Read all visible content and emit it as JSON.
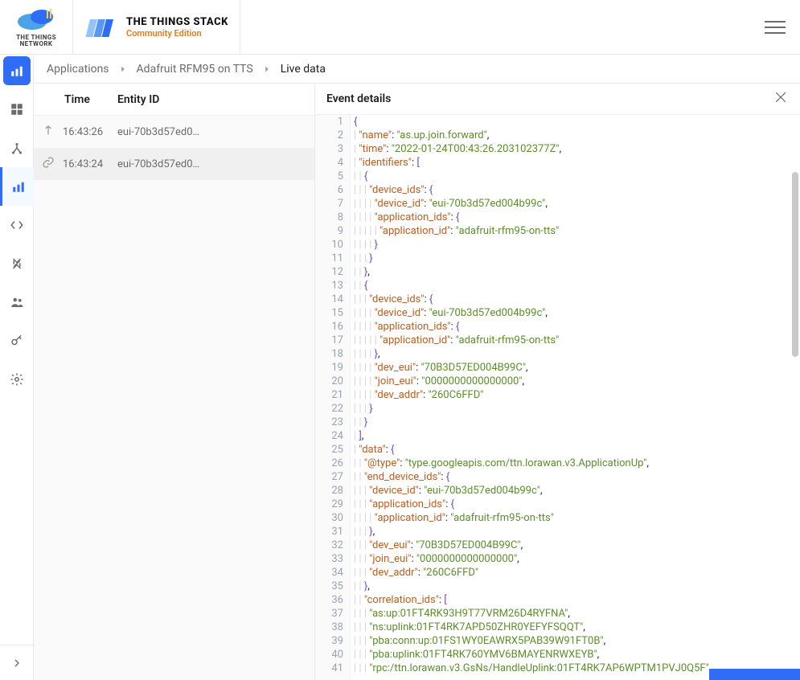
{
  "header": {
    "ttn_logo_line1": "THE THINGS",
    "ttn_logo_line2": "NETWORK",
    "tts_title": "THE THINGS STACK",
    "tts_sub": "Community Edition"
  },
  "breadcrumbs": {
    "a": "Applications",
    "b": "Adafruit RFM95 on TTS",
    "c": "Live data"
  },
  "list": {
    "th_time": "Time",
    "th_entity": "Entity ID",
    "rows": [
      {
        "icon": "up",
        "time": "16:43:26",
        "entity": "eui-70b3d57ed0…"
      },
      {
        "icon": "link",
        "time": "16:43:24",
        "entity": "eui-70b3d57ed0…"
      }
    ]
  },
  "detail": {
    "title": "Event details"
  },
  "json_lines": [
    {
      "i": 0,
      "t": [
        "b",
        "{"
      ]
    },
    {
      "i": 1,
      "t": [
        "k",
        "\"name\"",
        "p",
        ": ",
        "s",
        "\"as.up.join.forward\"",
        "p",
        ","
      ]
    },
    {
      "i": 1,
      "t": [
        "k",
        "\"time\"",
        "p",
        ": ",
        "s",
        "\"2022-01-24T00:43:26.203102377Z\"",
        "p",
        ","
      ]
    },
    {
      "i": 1,
      "t": [
        "k",
        "\"identifiers\"",
        "p",
        ": ",
        "b",
        "["
      ]
    },
    {
      "i": 2,
      "t": [
        "b",
        "{"
      ]
    },
    {
      "i": 3,
      "t": [
        "k",
        "\"device_ids\"",
        "p",
        ": ",
        "b",
        "{"
      ]
    },
    {
      "i": 4,
      "t": [
        "k",
        "\"device_id\"",
        "p",
        ": ",
        "s",
        "\"eui-70b3d57ed004b99c\"",
        "p",
        ","
      ]
    },
    {
      "i": 4,
      "t": [
        "k",
        "\"application_ids\"",
        "p",
        ": ",
        "b",
        "{"
      ]
    },
    {
      "i": 5,
      "t": [
        "k",
        "\"application_id\"",
        "p",
        ": ",
        "s",
        "\"adafruit-rfm95-on-tts\""
      ]
    },
    {
      "i": 4,
      "t": [
        "b",
        "}"
      ]
    },
    {
      "i": 3,
      "t": [
        "b",
        "}"
      ]
    },
    {
      "i": 2,
      "t": [
        "b",
        "}",
        "p",
        ","
      ]
    },
    {
      "i": 2,
      "t": [
        "b",
        "{"
      ]
    },
    {
      "i": 3,
      "t": [
        "k",
        "\"device_ids\"",
        "p",
        ": ",
        "b",
        "{"
      ]
    },
    {
      "i": 4,
      "t": [
        "k",
        "\"device_id\"",
        "p",
        ": ",
        "s",
        "\"eui-70b3d57ed004b99c\"",
        "p",
        ","
      ]
    },
    {
      "i": 4,
      "t": [
        "k",
        "\"application_ids\"",
        "p",
        ": ",
        "b",
        "{"
      ]
    },
    {
      "i": 5,
      "t": [
        "k",
        "\"application_id\"",
        "p",
        ": ",
        "s",
        "\"adafruit-rfm95-on-tts\""
      ]
    },
    {
      "i": 4,
      "t": [
        "b",
        "}",
        "p",
        ","
      ]
    },
    {
      "i": 4,
      "t": [
        "k",
        "\"dev_eui\"",
        "p",
        ": ",
        "s",
        "\"70B3D57ED004B99C\"",
        "p",
        ","
      ]
    },
    {
      "i": 4,
      "t": [
        "k",
        "\"join_eui\"",
        "p",
        ": ",
        "s",
        "\"0000000000000000\"",
        "p",
        ","
      ]
    },
    {
      "i": 4,
      "t": [
        "k",
        "\"dev_addr\"",
        "p",
        ": ",
        "s",
        "\"260C6FFD\""
      ]
    },
    {
      "i": 3,
      "t": [
        "b",
        "}"
      ]
    },
    {
      "i": 2,
      "t": [
        "b",
        "}"
      ]
    },
    {
      "i": 1,
      "t": [
        "b",
        "]",
        "p",
        ","
      ]
    },
    {
      "i": 1,
      "t": [
        "k",
        "\"data\"",
        "p",
        ": ",
        "b",
        "{"
      ]
    },
    {
      "i": 2,
      "t": [
        "k",
        "\"@type\"",
        "p",
        ": ",
        "s",
        "\"type.googleapis.com/ttn.lorawan.v3.ApplicationUp\"",
        "p",
        ","
      ]
    },
    {
      "i": 2,
      "t": [
        "k",
        "\"end_device_ids\"",
        "p",
        ": ",
        "b",
        "{"
      ]
    },
    {
      "i": 3,
      "t": [
        "k",
        "\"device_id\"",
        "p",
        ": ",
        "s",
        "\"eui-70b3d57ed004b99c\"",
        "p",
        ","
      ]
    },
    {
      "i": 3,
      "t": [
        "k",
        "\"application_ids\"",
        "p",
        ": ",
        "b",
        "{"
      ]
    },
    {
      "i": 4,
      "t": [
        "k",
        "\"application_id\"",
        "p",
        ": ",
        "s",
        "\"adafruit-rfm95-on-tts\""
      ]
    },
    {
      "i": 3,
      "t": [
        "b",
        "}",
        "p",
        ","
      ]
    },
    {
      "i": 3,
      "t": [
        "k",
        "\"dev_eui\"",
        "p",
        ": ",
        "s",
        "\"70B3D57ED004B99C\"",
        "p",
        ","
      ]
    },
    {
      "i": 3,
      "t": [
        "k",
        "\"join_eui\"",
        "p",
        ": ",
        "s",
        "\"0000000000000000\"",
        "p",
        ","
      ]
    },
    {
      "i": 3,
      "t": [
        "k",
        "\"dev_addr\"",
        "p",
        ": ",
        "s",
        "\"260C6FFD\""
      ]
    },
    {
      "i": 2,
      "t": [
        "b",
        "}",
        "p",
        ","
      ]
    },
    {
      "i": 2,
      "t": [
        "k",
        "\"correlation_ids\"",
        "p",
        ": ",
        "b",
        "["
      ]
    },
    {
      "i": 3,
      "t": [
        "s",
        "\"as:up:01FT4RK93H9T77VRM26D4RYFNA\"",
        "p",
        ","
      ]
    },
    {
      "i": 3,
      "t": [
        "s",
        "\"ns:uplink:01FT4RK7APD50ZHR0YEFYFSQQT\"",
        "p",
        ","
      ]
    },
    {
      "i": 3,
      "t": [
        "s",
        "\"pba:conn:up:01FS1WY0EAWRX5PAB39W91FT0B\"",
        "p",
        ","
      ]
    },
    {
      "i": 3,
      "t": [
        "s",
        "\"pba:uplink:01FT4RK760YMV6BMAYENRWXEYB\"",
        "p",
        ","
      ]
    },
    {
      "i": 3,
      "t": [
        "s",
        "\"rpc:/ttn.lorawan.v3.GsNs/HandleUplink:01FT4RK7AP6WPTM1PVJ0Q5F\""
      ]
    }
  ]
}
